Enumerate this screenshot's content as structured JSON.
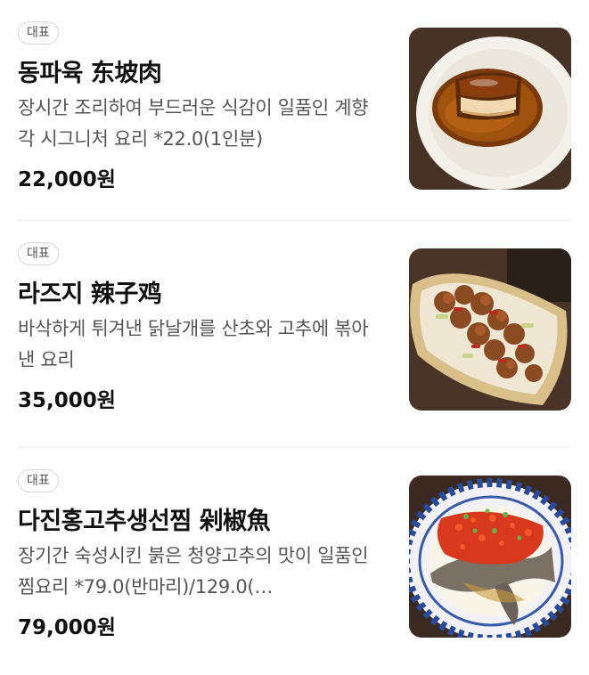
{
  "menu": {
    "items": [
      {
        "badge": "대표",
        "name": "동파육 东坡肉",
        "description": "장시간 조리하여 부드러운 식감이 일품인 계향각 시그니처 요리 *22.0(1인분)",
        "price": "22,000원",
        "image_icon": "dongpo-pork-photo"
      },
      {
        "badge": "대표",
        "name": "라즈지 辣子鸡",
        "description": "바삭하게 튀겨낸 닭날개를 산초와 고추에 볶아낸 요리",
        "price": "35,000원",
        "image_icon": "laziji-chicken-photo"
      },
      {
        "badge": "대표",
        "name": "다진홍고추생선찜 剁椒魚",
        "description": "장기간 숙성시킨 붉은 청양고추의 맛이 일품인 찜요리 *79.0(반마리)/129.0(…",
        "price": "79,000원",
        "image_icon": "steamed-fish-photo"
      }
    ]
  }
}
